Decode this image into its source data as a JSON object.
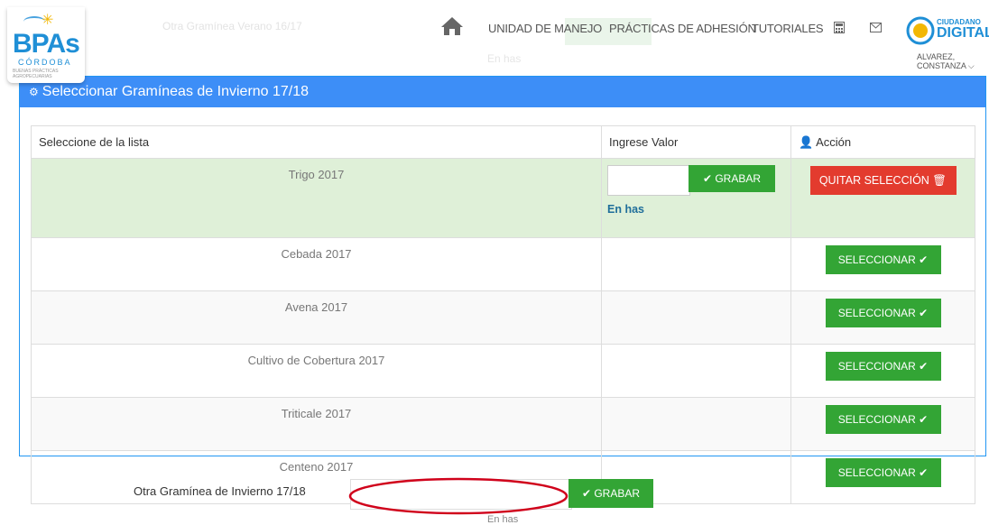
{
  "ghost": {
    "title": "Otra Gramínea Verano 16/17",
    "enhas": "En has"
  },
  "logo": {
    "main": "BPAs",
    "sub": "CÓRDOBA",
    "tiny": "BUENAS PRÁCTICAS AGROPECUARIAS"
  },
  "nav": {
    "links": [
      "UNIDAD DE MANEJO",
      "PRÁCTICAS DE ADHESIÓN",
      "TUTORIALES"
    ],
    "icons": [
      "home-icon",
      "calculator-icon",
      "envelope-icon"
    ],
    "brand_line1": "CIUDADANO",
    "brand_line2": "DIGITAL",
    "user": "ALVAREZ, CONSTANZA"
  },
  "panel": {
    "title": "Seleccionar Gramíneas de Invierno 17/18",
    "columns": [
      "Seleccione de la lista",
      "Ingrese Valor",
      "Acción"
    ],
    "selected_row": {
      "name": "Trigo 2017",
      "value": "",
      "unit": "En has",
      "save_label": "GRABAR",
      "remove_label": "QUITAR SELECCIÓN"
    },
    "rows": [
      {
        "name": "Cebada 2017",
        "action": "SELECCIONAR"
      },
      {
        "name": "Avena 2017",
        "action": "SELECCIONAR"
      },
      {
        "name": "Cultivo de Cobertura 2017",
        "action": "SELECCIONAR"
      },
      {
        "name": "Triticale 2017",
        "action": "SELECCIONAR"
      },
      {
        "name": "Centeno 2017",
        "action": "SELECCIONAR"
      }
    ]
  },
  "bottom": {
    "label": "Otra Gramínea de Invierno 17/18",
    "value": "",
    "save_label": "GRABAR",
    "unit": "En has"
  },
  "colors": {
    "panel_header": "#3d8ef7",
    "green": "#33a535",
    "red": "#e33b2e",
    "selected_row": "#dff0d8"
  }
}
